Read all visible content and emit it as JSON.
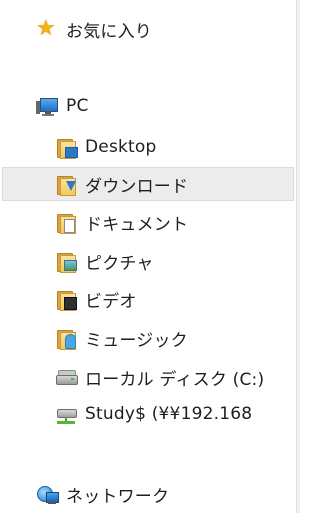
{
  "nav": {
    "favorites": {
      "label": "お気に入り",
      "icon": "star-icon"
    },
    "pc": {
      "label": "PC",
      "icon": "computer-icon"
    },
    "items": [
      {
        "label": "Desktop",
        "icon": "desktop-folder-icon"
      },
      {
        "label": "ダウンロード",
        "icon": "downloads-folder-icon",
        "selected": true
      },
      {
        "label": "ドキュメント",
        "icon": "documents-folder-icon"
      },
      {
        "label": "ピクチャ",
        "icon": "pictures-folder-icon"
      },
      {
        "label": "ビデオ",
        "icon": "videos-folder-icon"
      },
      {
        "label": "ミュージック",
        "icon": "music-folder-icon"
      },
      {
        "label": "ローカル ディスク (C:)",
        "icon": "local-disk-icon"
      },
      {
        "label": "Study$ (¥¥192.168",
        "icon": "network-drive-icon"
      }
    ],
    "network": {
      "label": "ネットワーク",
      "icon": "network-icon"
    }
  },
  "colors": {
    "selection_bg": "#ececec",
    "star": "#f2b01e",
    "folder": "#f2c85c",
    "accent_blue": "#2b78c8"
  }
}
